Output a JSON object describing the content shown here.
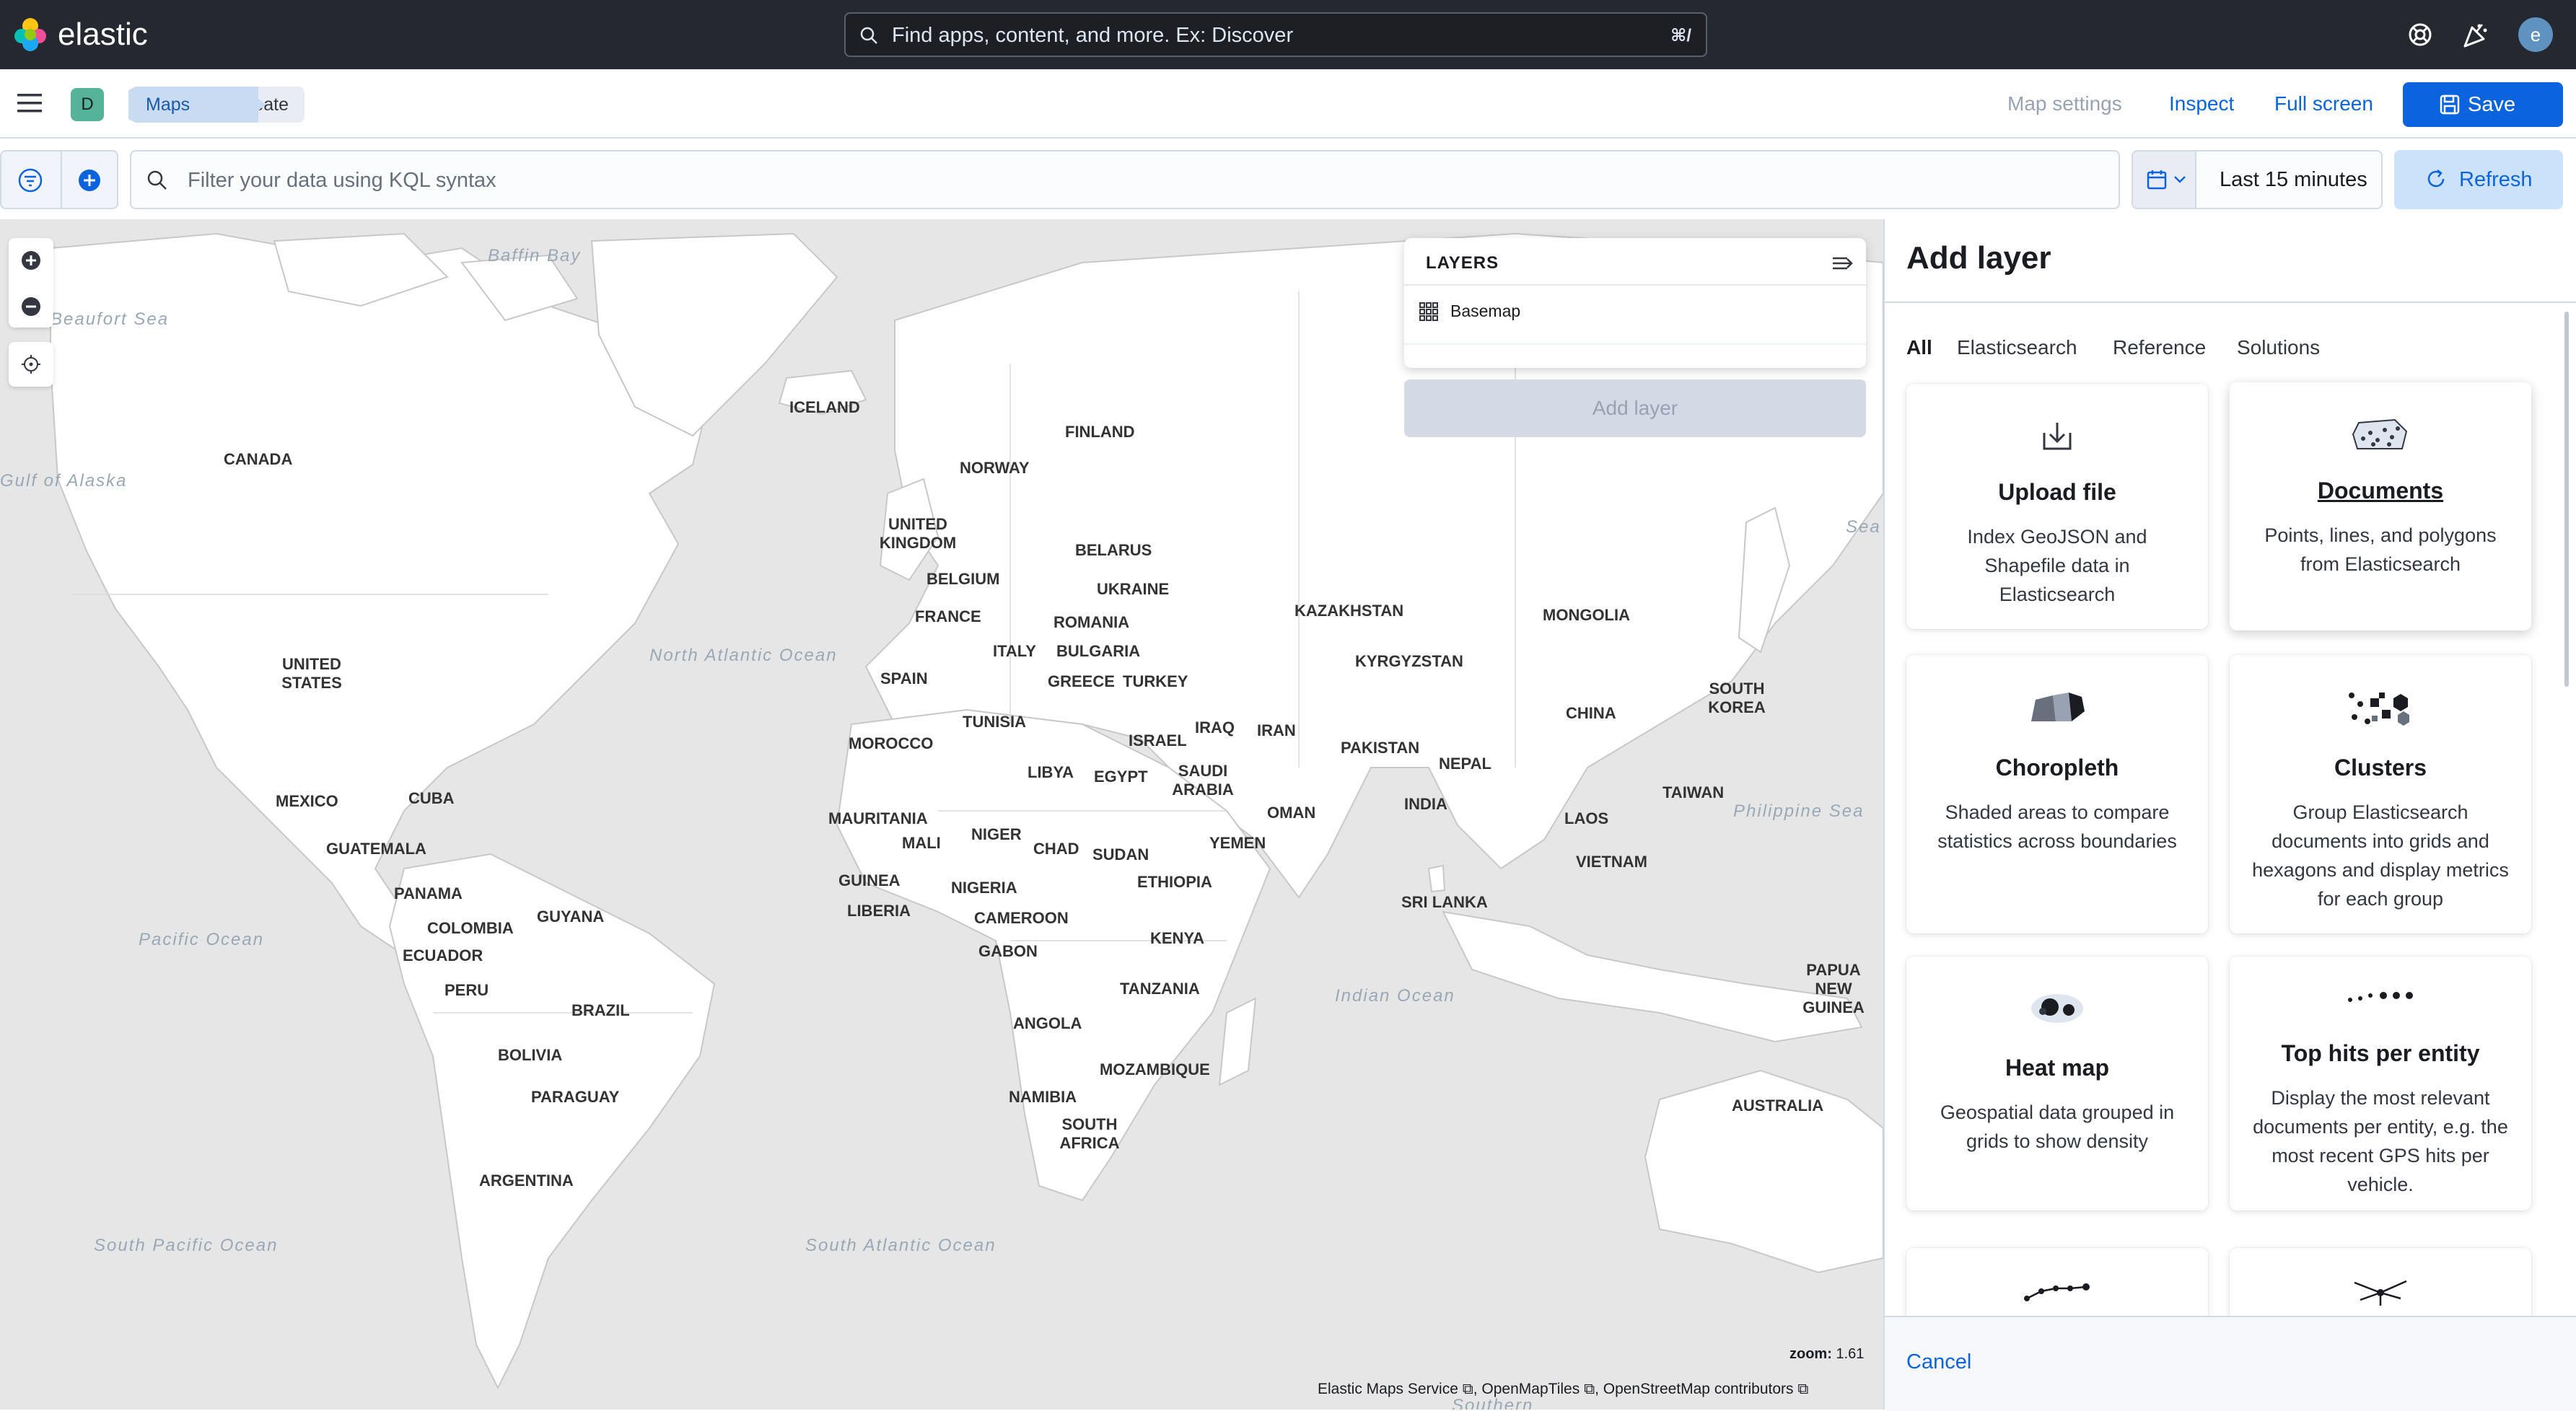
{
  "header": {
    "brand": "elastic",
    "search_placeholder": "Find apps, content, and more. Ex: Discover",
    "search_shortcut": "⌘/",
    "user_initial": "e"
  },
  "app_bar": {
    "space_initial": "D",
    "breadcrumbs": [
      "Maps",
      "Create"
    ],
    "map_settings": "Map settings",
    "inspect": "Inspect",
    "full_screen": "Full screen",
    "save": "Save"
  },
  "query_bar": {
    "kql_placeholder": "Filter your data using KQL syntax",
    "date_range": "Last 15 minutes",
    "refresh": "Refresh"
  },
  "map": {
    "layers_title": "LAYERS",
    "layers": [
      {
        "name": "Basemap"
      }
    ],
    "add_layer": "Add layer",
    "zoom_label": "zoom:",
    "zoom_value": "1.61",
    "attribution": [
      "Elastic Maps Service",
      "OpenMapTiles",
      "OpenStreetMap contributors"
    ],
    "country_labels": [
      "CANADA",
      "UNITED STATES",
      "MEXICO",
      "CUBA",
      "GUATEMALA",
      "PANAMA",
      "COLOMBIA",
      "GUYANA",
      "ECUADOR",
      "PERU",
      "BRAZIL",
      "BOLIVIA",
      "PARAGUAY",
      "ARGENTINA",
      "ICELAND",
      "FINLAND",
      "NORWAY",
      "UNITED KINGDOM",
      "BELARUS",
      "BELGIUM",
      "UKRAINE",
      "FRANCE",
      "ROMANIA",
      "ITALY",
      "BULGARIA",
      "SPAIN",
      "GREECE",
      "TURKEY",
      "KAZAKHSTAN",
      "KYRGYZSTAN",
      "MONGOLIA",
      "TUNISIA",
      "ISRAEL",
      "IRAQ",
      "IRAN",
      "MOROCCO",
      "LIBYA",
      "EGYPT",
      "SAUDI ARABIA",
      "PAKISTAN",
      "NEPAL",
      "CHINA",
      "SOUTH KOREA",
      "INDIA",
      "TAIWAN",
      "OMAN",
      "MAURITANIA",
      "MALI",
      "NIGER",
      "CHAD",
      "SUDAN",
      "YEMEN",
      "LAOS",
      "VIETNAM",
      "GUINEA",
      "NIGERIA",
      "ETHIOPIA",
      "LIBERIA",
      "CAMEROON",
      "GABON",
      "KENYA",
      "SRI LANKA",
      "TANZANIA",
      "ANGOLA",
      "MOZAMBIQUE",
      "NAMIBIA",
      "SOUTH AFRICA",
      "PAPUA NEW GUINEA",
      "AUSTRALIA"
    ],
    "ocean_labels": [
      "Baffin Bay",
      "Beaufort Sea",
      "Gulf of Alaska",
      "North Atlantic Ocean",
      "Sea of Okh",
      "Pacific Ocean",
      "Philippine Sea",
      "Indian Ocean",
      "South Pacific Ocean",
      "South Atlantic Ocean",
      "Southern"
    ]
  },
  "flyout": {
    "title": "Add layer",
    "tabs": [
      "All",
      "Elasticsearch",
      "Reference",
      "Solutions"
    ],
    "cards": [
      {
        "title": "Upload file",
        "icon": "upload-icon",
        "desc": "Index GeoJSON and Shapefile data in Elasticsearch"
      },
      {
        "title": "Documents",
        "icon": "documents-icon",
        "desc": "Points, lines, and polygons from Elasticsearch"
      },
      {
        "title": "Choropleth",
        "icon": "choropleth-icon",
        "desc": "Shaded areas to compare statistics across boundaries"
      },
      {
        "title": "Clusters",
        "icon": "clusters-icon",
        "desc": "Group Elasticsearch documents into grids and hexagons and display metrics for each group"
      },
      {
        "title": "Heat map",
        "icon": "heatmap-icon",
        "desc": "Geospatial data grouped in grids to show density"
      },
      {
        "title": "Top hits per entity",
        "icon": "top-hits-icon",
        "desc": "Display the most relevant documents per entity, e.g. the most recent GPS hits per vehicle."
      }
    ],
    "cancel": "Cancel"
  },
  "colors": {
    "header_bg": "#25282f",
    "primary": "#0b64dd",
    "land": "#ffffff",
    "water": "#e6e6e6",
    "breadcrumb_active": "#c8dbf2"
  }
}
